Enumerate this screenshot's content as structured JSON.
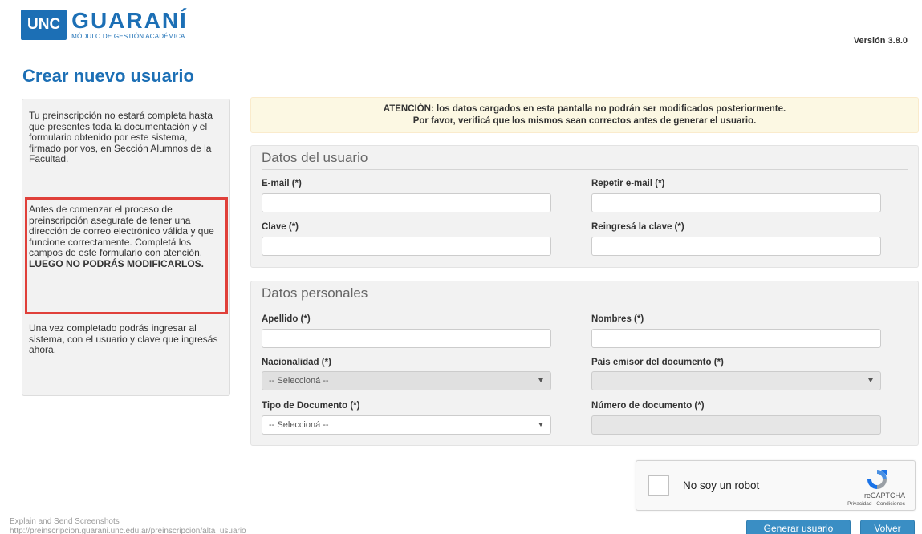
{
  "header": {
    "logo_unc": "UNC",
    "logo_title": "GUARANÍ",
    "logo_subtitle": "MÓDULO DE GESTIÓN ACADÉMICA",
    "version": "Versión 3.8.0"
  },
  "page_title": "Crear nuevo usuario",
  "sidebar": {
    "p1": "Tu preinscripción no estará completa hasta que presentes toda la documentación y el formulario obtenido por este sistema, firmado por vos, en Sección Alumnos de la Facultad.",
    "p2": "Antes de comenzar el proceso de preinscripción asegurate de tener una dirección de correo electrónico válida y que funcione correctamente. Completá los campos de este formulario con atención.",
    "p2_bold": "LUEGO NO PODRÁS MODIFICARLOS.",
    "p3": "Una vez completado podrás ingresar al sistema, con el usuario y clave que ingresás ahora."
  },
  "alert": {
    "line1": "ATENCIÓN: los datos cargados en esta pantalla no podrán ser modificados posteriormente.",
    "line2": "Por favor, verificá que los mismos sean correctos antes de generar el usuario."
  },
  "user_section": {
    "legend": "Datos del usuario",
    "email_label": "E-mail (*)",
    "email_value": "",
    "repeat_email_label": "Repetir e-mail (*)",
    "repeat_email_value": "",
    "password_label": "Clave (*)",
    "password_value": "",
    "repeat_password_label": "Reingresá la clave (*)",
    "repeat_password_value": ""
  },
  "personal_section": {
    "legend": "Datos personales",
    "surname_label": "Apellido (*)",
    "surname_value": "",
    "names_label": "Nombres (*)",
    "names_value": "",
    "nationality_label": "Nacionalidad (*)",
    "nationality_value": "-- Seleccioná --",
    "issuer_country_label": "País emisor del documento (*)",
    "issuer_country_value": "",
    "doc_type_label": "Tipo de Documento (*)",
    "doc_type_value": "-- Seleccioná --",
    "doc_number_label": "Número de documento (*)",
    "doc_number_value": ""
  },
  "captcha": {
    "label": "No soy un robot",
    "brand": "reCAPTCHA",
    "links": "Privacidad - Condiciones"
  },
  "buttons": {
    "generate": "Generar usuario",
    "back": "Volver"
  },
  "footer": {
    "line1": "Explain and Send Screenshots",
    "line2": "http://preinscripcion.guarani.unc.edu.ar/preinscripcion/alta_usuario"
  },
  "colors": {
    "brand_blue": "#1c6fb5",
    "button_blue": "#3a8ec4",
    "highlight_red": "#e0403a",
    "alert_bg": "#fcf8e3"
  }
}
